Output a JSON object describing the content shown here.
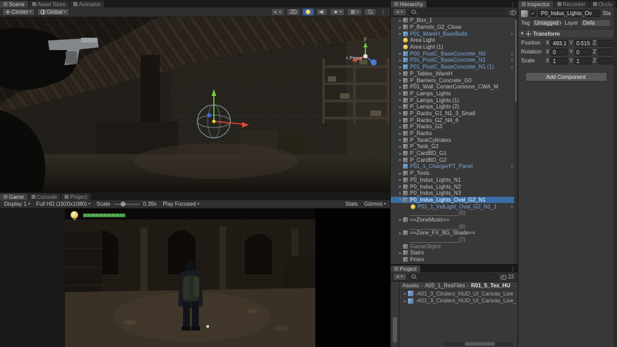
{
  "tabs": {
    "scene_area": [
      "Scene",
      "Asset Store",
      "Animator"
    ],
    "game_area": [
      "Game",
      "Console",
      "Project"
    ],
    "hierarchy": "Hierarchy",
    "project": "Project",
    "inspector_area": [
      "Inspector",
      "Recorder",
      "Occlu"
    ]
  },
  "icons": {
    "caret": "▾",
    "arrow_right": "▸",
    "arrow_down": "▾",
    "open_arrow": "›",
    "crumb_sep": "›",
    "plus": "+",
    "menu_dots": "⋮",
    "shaded_sphere": "◐",
    "effects_star": "★",
    "grid": "⊞"
  },
  "scene_toolbar": {
    "pivot": "Center",
    "space": "Global",
    "mode_2d": "2D"
  },
  "scene_view": {
    "persp_label": "< Persp",
    "axis_y": "y"
  },
  "game_toolbar": {
    "display": "Display 1",
    "resolution": "Full HD (1920x1080)",
    "scale_label": "Scale",
    "scale_value": "0.39x",
    "play_focused": "Play Focused",
    "stats": "Stats",
    "gizmos": "Gizmos"
  },
  "hierarchy": {
    "items": [
      {
        "label": "P_Box_1",
        "arrow": "r",
        "icon": "cube"
      },
      {
        "label": "P_Barrels_G2_Close",
        "arrow": "r",
        "icon": "cube"
      },
      {
        "label": "P01_WareH_BaseBuild",
        "arrow": "r",
        "icon": "prefab",
        "color": "prefab",
        "open": true
      },
      {
        "label": "Area Light",
        "icon": "light"
      },
      {
        "label": "Area Light (1)",
        "icon": "light"
      },
      {
        "label": "P00_PostC_BaseConcrete_N0",
        "arrow": "r",
        "icon": "prefab",
        "color": "prefab",
        "open": true
      },
      {
        "label": "P01_PostC_BaseConcrete_N1",
        "arrow": "r",
        "icon": "prefab",
        "color": "prefab",
        "open": true
      },
      {
        "label": "P01_PostC_BaseConcrete_N1 (1)",
        "arrow": "r",
        "icon": "prefab",
        "color": "prefab",
        "open": true
      },
      {
        "label": "P_Tables_WareH",
        "arrow": "r",
        "icon": "cube"
      },
      {
        "label": "P_Barriers_Concrete_G0",
        "arrow": "r",
        "icon": "cube"
      },
      {
        "label": "P01_Wall_CenterCommon_CWA_M",
        "arrow": "r",
        "icon": "cube"
      },
      {
        "label": "P_Lamps_Lights",
        "arrow": "r",
        "icon": "cube"
      },
      {
        "label": "P_Lamps_Lights (1)",
        "arrow": "r",
        "icon": "cube"
      },
      {
        "label": "P_Lamps_Lights (2)",
        "arrow": "r",
        "icon": "cube"
      },
      {
        "label": "P_Racks_G1_N1_3_Small",
        "arrow": "r",
        "icon": "cube"
      },
      {
        "label": "P_Racks_G2_N4_6",
        "arrow": "r",
        "icon": "cube"
      },
      {
        "label": "P_Racks_G3",
        "arrow": "r",
        "icon": "cube"
      },
      {
        "label": "P_Racks",
        "arrow": "r",
        "icon": "cube"
      },
      {
        "label": "P_TankCylinders",
        "arrow": "r",
        "icon": "cube"
      },
      {
        "label": "P_Tank_G2",
        "arrow": "r",
        "icon": "cube"
      },
      {
        "label": "P_CardBD_G1",
        "arrow": "r",
        "icon": "cube"
      },
      {
        "label": "P_CardBD_G2",
        "arrow": "r",
        "icon": "cube"
      },
      {
        "label": "P01_1_ChargerPT_Panel",
        "icon": "prefab",
        "color": "prefab",
        "open": true
      },
      {
        "label": "P_Tools",
        "arrow": "r",
        "icon": "cube"
      },
      {
        "label": "P0_Indus_Lights_N1",
        "arrow": "r",
        "icon": "cube"
      },
      {
        "label": "P0_Indus_Lights_N2",
        "arrow": "r",
        "icon": "cube"
      },
      {
        "label": "P0_Indus_Lights_N3",
        "arrow": "r",
        "icon": "cube"
      },
      {
        "label": "P0_Indus_Lights_Oval_G2_N1",
        "arrow": "d",
        "icon": "cube",
        "selected": true
      },
      {
        "label": "P01_1_IndLight_Oval_G2_N1_1",
        "depth": 1,
        "icon": "light",
        "color": "prefab",
        "open": true
      },
      {
        "label": "________________(5)",
        "color": "dim"
      },
      {
        "label": "==ZoneMusic==",
        "arrow": "r",
        "icon": "cube"
      },
      {
        "label": "________________(6)",
        "color": "dim"
      },
      {
        "label": "==Zone_FX_BG_Shade==",
        "arrow": "r",
        "icon": "cube"
      },
      {
        "label": "________________(7)",
        "color": "dim"
      },
      {
        "label": "GameObject",
        "icon": "cube",
        "color": "dim"
      },
      {
        "label": "Stairs",
        "arrow": "r",
        "icon": "cube"
      },
      {
        "label": "Prism",
        "icon": "cube"
      }
    ]
  },
  "project": {
    "breadcrumb": [
      "Assets",
      "A00_1_ResFiles",
      "R01_5_Tex_HU"
    ],
    "count": "22",
    "items": [
      {
        "label": "-A01_3_Cinders_HUD_UI_Canvas_Live"
      },
      {
        "label": "-A01_3_Cinders_HUD_UI_Canvas_Live_"
      }
    ]
  },
  "inspector": {
    "name": "P0_Indus_Lights_Ov",
    "static_label": "Sta",
    "tag_label": "Tag",
    "tag_value": "Untagged",
    "layer_label": "Layer",
    "layer_value": "Defa",
    "transform": {
      "title": "Transform",
      "axis": {
        "x": "X",
        "y": "Y",
        "z": "Z"
      },
      "rows": [
        {
          "label": "Position",
          "x": "493.12",
          "y": "0.515",
          "z": ""
        },
        {
          "label": "Rotation",
          "x": "0",
          "y": "0",
          "z": ""
        },
        {
          "label": "Scale",
          "x": "1",
          "y": "1",
          "z": ""
        }
      ]
    },
    "add_component": "Add Component"
  }
}
